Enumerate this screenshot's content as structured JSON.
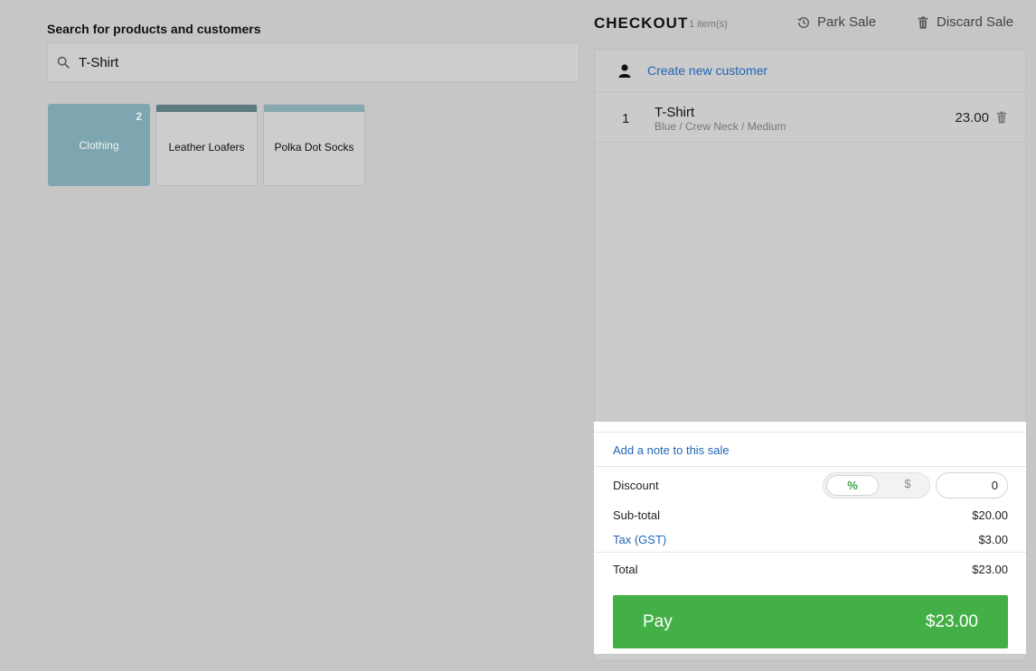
{
  "search": {
    "label": "Search for products and customers",
    "value": "T-Shirt"
  },
  "tiles": [
    {
      "label": "Clothing",
      "count": "2",
      "type": "category",
      "color": "#7ea6b0"
    },
    {
      "label": "Leather Loafers",
      "type": "product",
      "band_color": "#5d7a7f"
    },
    {
      "label": "Polka Dot Socks",
      "type": "product",
      "band_color": "#86a8b0"
    }
  ],
  "checkout": {
    "title": "CHECKOUT",
    "item_count": "1 item(s)",
    "park_sale": "Park Sale",
    "discard_sale": "Discard Sale",
    "create_customer": "Create new customer",
    "line_items": [
      {
        "qty": "1",
        "name": "T-Shirt",
        "variant": "Blue / Crew Neck / Medium",
        "price": "23.00"
      }
    ],
    "add_note": "Add a note to this sale",
    "discount_label": "Discount",
    "discount_percent": "%",
    "discount_dollar": "$",
    "discount_value": "0",
    "subtotal_label": "Sub-total",
    "subtotal_value": "$20.00",
    "tax_label": "Tax (GST)",
    "tax_value": "$3.00",
    "total_label": "Total",
    "total_value": "$23.00",
    "pay_label": "Pay",
    "pay_amount": "$23.00"
  },
  "colors": {
    "background": "#c6c6c6",
    "link": "#1f66b5",
    "pay_button": "#43b047",
    "discount_active": "#3aa54a"
  }
}
